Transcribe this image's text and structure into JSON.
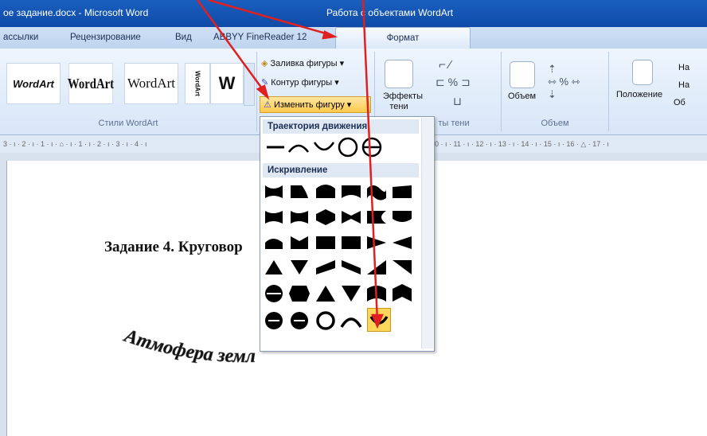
{
  "window": {
    "title": "ое задание.docx - Microsoft Word",
    "context_tab": "Работа с объектами WordArt"
  },
  "tabs": [
    "ассылки",
    "Рецензирование",
    "Вид",
    "ABBYY FineReader 12",
    "Формат"
  ],
  "ribbon": {
    "wordart_styles": {
      "label": "Стили WordArt",
      "samples": [
        "WordArt",
        "WordArt",
        "WordArt",
        "WordArt",
        "W"
      ]
    },
    "fill_label": "Заливка фигуры",
    "outline_label": "Контур фигуры",
    "change_shape_label": "Изменить фигуру",
    "shadow": {
      "effects_label": "Эффекты тени",
      "group_label": "ты тени"
    },
    "volume": {
      "button_label": "Объем",
      "group_label": "Объем"
    },
    "arrange": {
      "position_label": "Положение",
      "item1": "На",
      "item2": "На",
      "item3": "Об"
    }
  },
  "ruler": "3 · ı · 2 · ı · 1 · ı · ⌂ · ı · 1 · ı · 2 · ı · 3 · ı · 4 · ı",
  "ruler_right": "0 · ı · 11 · ı · 12 · ı · 13 · ı · 14 · ı · 15 · ı · 16 · △ · 17 · ı",
  "dropdown": {
    "section_path": "Траектория движения",
    "section_warp": "Искривление"
  },
  "document": {
    "task_text": "Задание 4. Круговор",
    "wordart_text": "Атмофера земл"
  },
  "colors": {
    "title_bar": "#1a5fbf",
    "highlight": "#ffd65c",
    "arrow": "#e02020"
  }
}
